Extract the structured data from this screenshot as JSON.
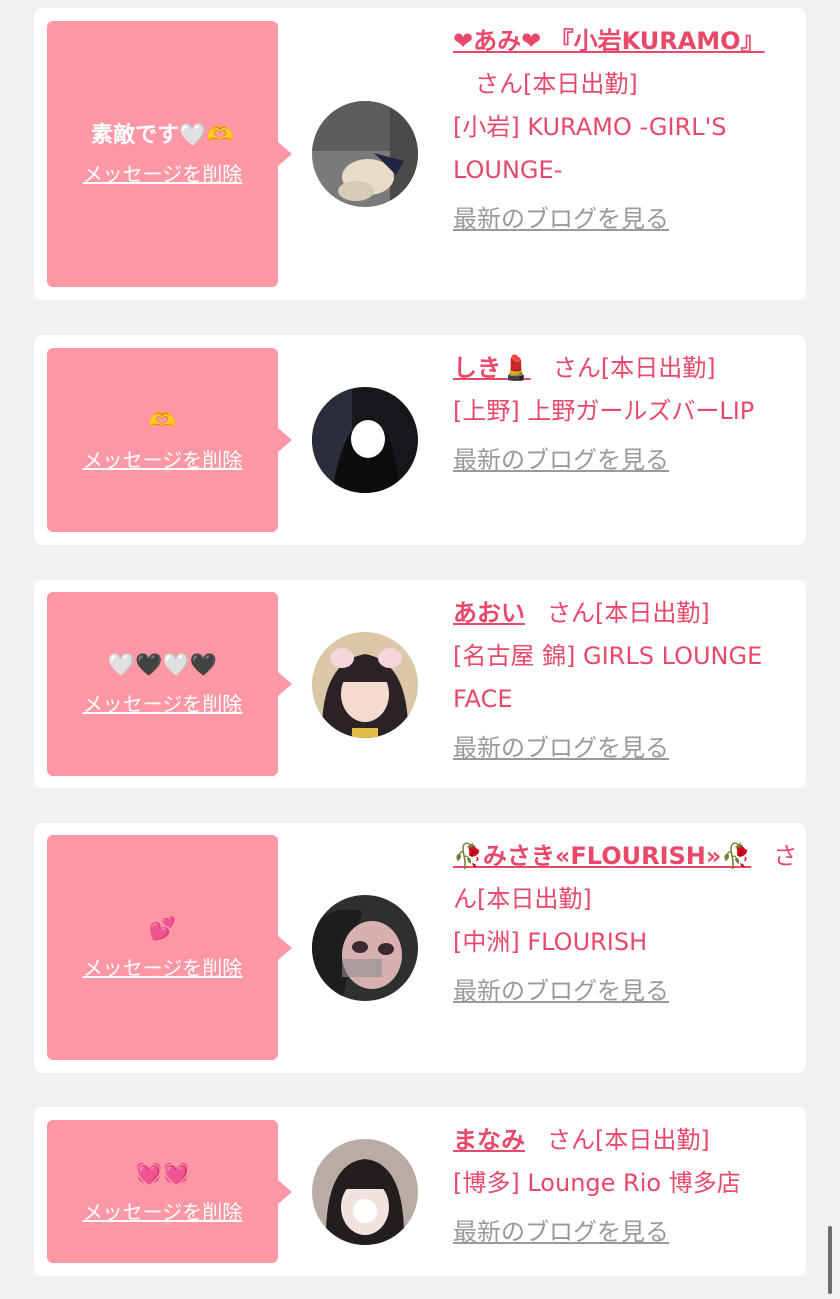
{
  "delete_label": "メッセージを削除",
  "blog_label": "最新のブログを見る",
  "cards": [
    {
      "message": "素敵です🤍🫶",
      "name": "❤あみ❤ 『小岩KURAMO』",
      "san": "さん",
      "status": "[本日出勤]",
      "shop": "[小岩] KURAMO -GIRL'S LOUNGE-"
    },
    {
      "message": "🫶",
      "name": "しき💄",
      "san": "さん",
      "status": "[本日出勤]",
      "shop": "[上野] 上野ガールズバーLIP"
    },
    {
      "message": "🤍🖤🤍🖤",
      "name": "あおい",
      "san": "さん",
      "status": "[本日出勤]",
      "shop": "[名古屋 錦] GIRLS LOUNGE FACE"
    },
    {
      "message": "💕",
      "name": "🥀みさき«FLOURISH»🥀",
      "san": "さん",
      "status": "[本日出勤]",
      "shop": "[中洲] FLOURISH"
    },
    {
      "message": "💓💓",
      "name": "まなみ",
      "san": "さん",
      "status": "[本日出勤]",
      "shop": "[博多] Lounge Rio 博多店"
    }
  ]
}
